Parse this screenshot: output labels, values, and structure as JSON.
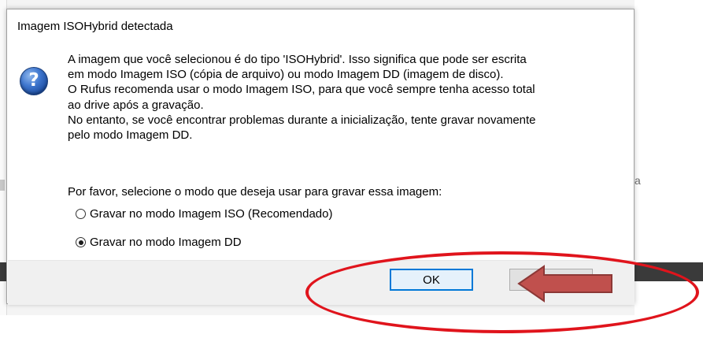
{
  "background": {
    "right_glyph": "a"
  },
  "dialog": {
    "title": "Imagem ISOHybrid detectada",
    "icon": "question-icon",
    "icon_glyph": "?",
    "message_lines": [
      "A imagem que você selecionou é do tipo 'ISOHybrid'. Isso significa que pode ser escrita",
      "em modo Imagem ISO (cópia de arquivo) ou modo Imagem DD (imagem de disco).",
      "O Rufus recomenda usar o modo Imagem ISO, para que você sempre tenha acesso total",
      "ao drive após a gravação.",
      "No entanto, se você encontrar problemas durante a inicialização, tente gravar novamente",
      "pelo modo Imagem DD."
    ],
    "prompt": "Por favor, selecione o modo que deseja usar para gravar essa imagem:",
    "options": [
      {
        "label": "Gravar no modo Imagem ISO (Recomendado)",
        "selected": false
      },
      {
        "label": "Gravar no modo Imagem DD",
        "selected": true
      }
    ],
    "buttons": {
      "ok": "OK"
    }
  },
  "annotation": {
    "color": "#e0141c",
    "arrow_color": "#c0504d",
    "arrow_icon": "left-arrow-icon"
  }
}
